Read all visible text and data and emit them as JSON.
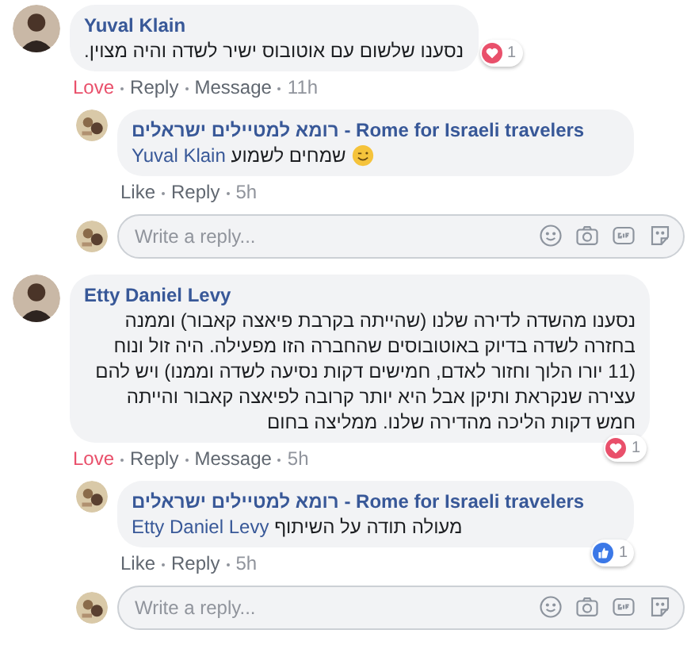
{
  "comments": [
    {
      "author": "Yuval Klain",
      "text": "נסענו שלשום עם אוטובוס ישיר לשדה והיה מצוין.",
      "reaction": {
        "kind": "love",
        "count": "1"
      },
      "react_link": {
        "label": "Love",
        "active": true
      },
      "reply_link": "Reply",
      "message_link": "Message",
      "time": "11h",
      "replies": [
        {
          "author": "רומא למטיילים ישראלים - Rome for Israeli travelers",
          "mention": "Yuval Klain",
          "text": "שמחים לשמוע",
          "has_emoji": true,
          "react_link": {
            "label": "Like",
            "active": false
          },
          "reply_link": "Reply",
          "time": "5h"
        }
      ],
      "reply_box": {
        "placeholder": "Write a reply..."
      }
    },
    {
      "author": "Etty Daniel Levy",
      "text": "נסענו מהשדה לדירה שלנו (שהייתה בקרבת פיאצה קאבור) וממנה בחזרה לשדה בדיוק באוטובוסים שהחברה הזו מפעילה. היה זול ונוח (11 יורו הלוך וחזור לאדם, חמישים דקות נסיעה לשדה וממנו) ויש להם עצירה שנקראת ותיקן אבל היא יותר קרובה לפיאצה קאבור והייתה חמש דקות הליכה מהדירה שלנו. ממליצה בחום",
      "reaction": {
        "kind": "love",
        "count": "1"
      },
      "react_link": {
        "label": "Love",
        "active": true
      },
      "reply_link": "Reply",
      "message_link": "Message",
      "time": "5h",
      "replies": [
        {
          "author": "רומא למטיילים ישראלים - Rome for Israeli travelers",
          "mention": "Etty Daniel Levy",
          "text": "מעולה תודה על השיתוף",
          "reaction": {
            "kind": "like",
            "count": "1"
          },
          "react_link": {
            "label": "Like",
            "active": false
          },
          "reply_link": "Reply",
          "time": "5h"
        }
      ],
      "reply_box": {
        "placeholder": "Write a reply..."
      }
    }
  ]
}
